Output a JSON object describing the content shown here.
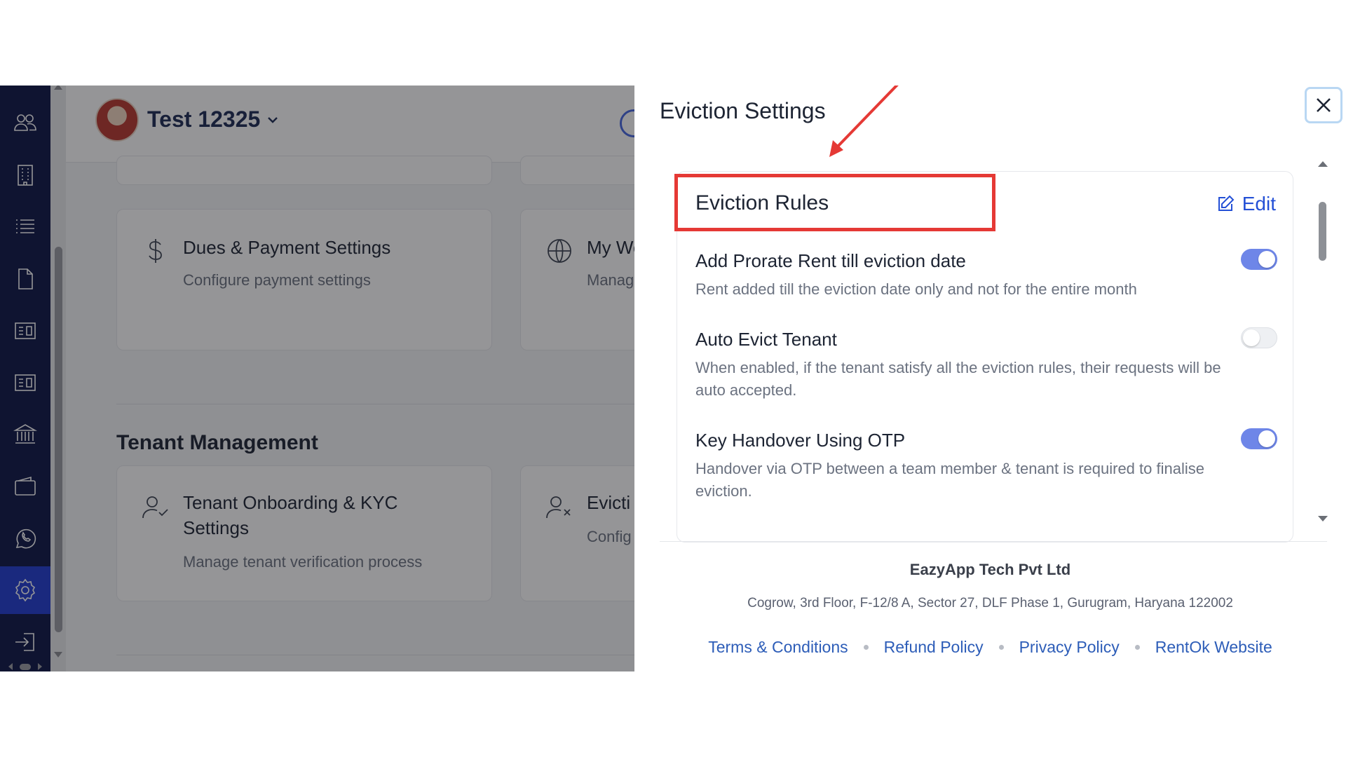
{
  "app": {
    "org_name": "Test 12325",
    "cards": {
      "dues_title": "Dues & Payment Settings",
      "dues_sub": "Configure payment settings",
      "website_title_peek": "My We",
      "website_sub_peek": "Manag",
      "kyc_title": "Tenant Onboarding & KYC Settings",
      "kyc_sub": "Manage tenant verification process",
      "eviction_title_peek": "Evicti",
      "eviction_sub_peek": "Config"
    },
    "section_tenant_management": "Tenant Management",
    "sidebar_icons": [
      "users-icon",
      "building-icon",
      "list-icon",
      "document-icon",
      "ledger-icon",
      "ledger-icon",
      "bank-icon",
      "wallet-icon",
      "whatsapp-icon",
      "settings-icon",
      "logout-icon"
    ],
    "active_sidebar": "settings-icon"
  },
  "modal": {
    "title": "Eviction Settings",
    "section_title": "Eviction Rules",
    "edit_label": "Edit",
    "rules": [
      {
        "title": "Add Prorate Rent till eviction date",
        "description": "Rent added till the eviction date only and not for the entire month",
        "enabled": true
      },
      {
        "title": "Auto Evict Tenant",
        "description": "When enabled, if the tenant satisfy all the eviction rules, their requests will be auto accepted.",
        "enabled": false
      },
      {
        "title": "Key Handover Using OTP",
        "description": "Handover via OTP between a team member & tenant is required to finalise eviction.",
        "enabled": true
      }
    ],
    "footer": {
      "company": "EazyApp Tech Pvt Ltd",
      "address": "Cogrow, 3rd Floor, F-12/8 A, Sector 27, DLF Phase 1, Gurugram, Haryana 122002",
      "links": [
        "Terms & Conditions",
        "Refund Policy",
        "Privacy Policy",
        "RentOk Website"
      ]
    }
  },
  "colors": {
    "sidebar_bg": "#0c1445",
    "sidebar_active": "#1f3bd1",
    "toggle_on": "#6e86e8",
    "link": "#2d5db8",
    "edit": "#2450d6",
    "annotation": "#e53935"
  }
}
